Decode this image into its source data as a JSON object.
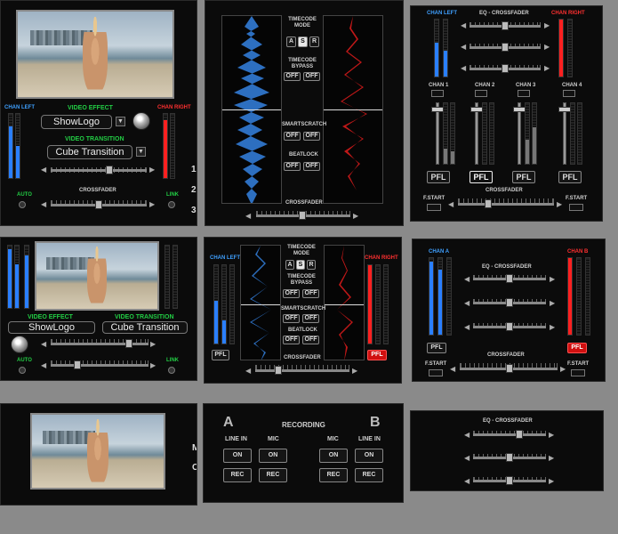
{
  "panel1": {
    "chan_left": "CHAN LEFT",
    "chan_right": "CHAN RIGHT",
    "video_effect_label": "VIDEO EFFECT",
    "video_effect_value": "ShowLogo",
    "video_transition_label": "VIDEO TRANSITION",
    "video_transition_value": "Cube Transition",
    "auto": "AUTO",
    "crossfader": "CROSSFADER",
    "link": "LINK",
    "side_numbers": [
      "1",
      "2",
      "3"
    ]
  },
  "panel2": {
    "timecode_mode": "TIMECODE MODE",
    "mode_buttons": [
      "A",
      "S",
      "R"
    ],
    "timecode_bypass": "TIMECODE BYPASS",
    "smartscratch": "SMARTSCRATCH",
    "beatlock": "BEATLOCK",
    "off": "OFF",
    "crossfader": "CROSSFADER"
  },
  "panel3": {
    "chan_left": "CHAN LEFT",
    "eq_crossfader": "EQ - CROSSFADER",
    "chan_right": "CHAN RIGHT",
    "channels": [
      "CHAN 1",
      "CHAN 2",
      "CHAN 3",
      "CHAN 4"
    ],
    "pfl": "PFL",
    "fstart": "F.START",
    "crossfader": "CROSSFADER"
  },
  "panel4": {
    "video_effect_label": "VIDEO EFFECT",
    "video_effect_value": "ShowLogo",
    "video_transition_label": "VIDEO TRANSITION",
    "video_transition_value": "Cube Transition",
    "auto": "AUTO",
    "link": "LINK"
  },
  "panel5": {
    "chan_left": "CHAN LEFT",
    "chan_right": "CHAN RIGHT",
    "timecode_mode": "TIMECODE MODE",
    "mode_buttons": [
      "A",
      "S",
      "R"
    ],
    "timecode_bypass": "TIMECODE BYPASS",
    "smartscratch": "SMARTSCRATCH",
    "beatlock": "BEATLOCK",
    "off": "OFF",
    "pfl": "PFL",
    "crossfader": "CROSSFADER"
  },
  "panel6": {
    "chan_a": "CHAN A",
    "eq_crossfader": "EQ - CROSSFADER",
    "chan_b": "CHAN B",
    "pfl": "PFL",
    "fstart": "F.START",
    "crossfader": "CROSSFADER"
  },
  "panel7": {
    "side_letters": [
      "M",
      "C"
    ]
  },
  "panel8": {
    "deck_a": "A",
    "recording": "RECORDING",
    "deck_b": "B",
    "line_in": "LINE IN",
    "mic": "MIC",
    "on": "ON",
    "rec": "REC"
  },
  "panel9": {
    "eq_crossfader": "EQ - CROSSFADER"
  },
  "colors": {
    "blue": "#3fa0ff",
    "red": "#ff3030",
    "green": "#22cc44",
    "pfl_active": "#d01010"
  }
}
